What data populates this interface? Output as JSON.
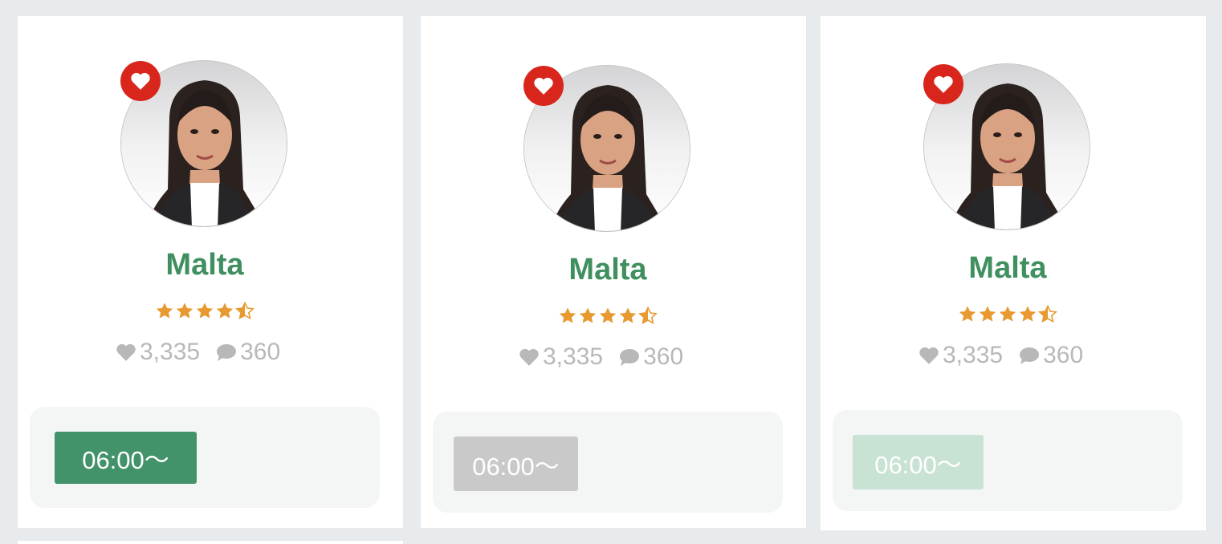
{
  "cards": [
    {
      "name": "Malta",
      "rating": 4.5,
      "likes": "3,335",
      "comments": "360",
      "time": "06:00〜",
      "status": "available",
      "button_color": "#43936a"
    },
    {
      "name": "Malta",
      "rating": 4.5,
      "likes": "3,335",
      "comments": "360",
      "time": "06:00〜",
      "status": "unavailable",
      "button_color": "#c9c9c9"
    },
    {
      "name": "Malta",
      "rating": 4.5,
      "likes": "3,335",
      "comments": "360",
      "time": "06:00〜",
      "status": "faded",
      "button_color": "#c8e2d3"
    }
  ],
  "colors": {
    "name": "#3f8f5f",
    "star": "#e8992f",
    "favorite_badge": "#d9261c",
    "stat_text": "#b8b8b8",
    "background": "#e8ebee"
  },
  "icons": {
    "favorite": "heart-icon",
    "likes": "heart-icon",
    "comments": "speech-bubble-icon",
    "rating": "star-icon"
  }
}
